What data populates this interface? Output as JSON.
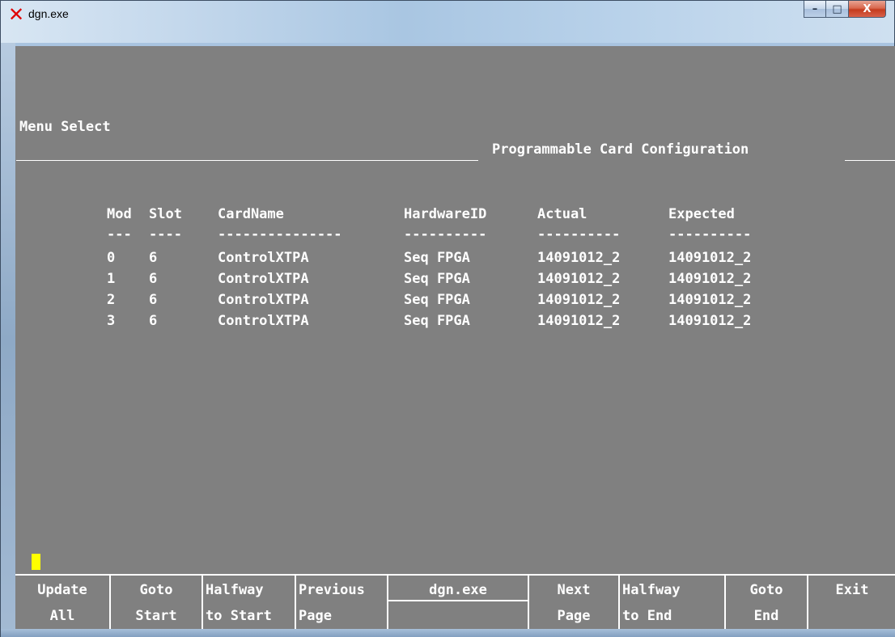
{
  "window": {
    "title": "dgn.exe",
    "minimize_glyph": "–",
    "maximize_glyph": "□",
    "close_glyph": "X",
    "app_icon": "x-logo-icon"
  },
  "screen": {
    "menu_label": "Menu Select",
    "section_title": "Programmable Card Configuration"
  },
  "table": {
    "headers": [
      "Mod",
      "Slot",
      "CardName",
      "HardwareID",
      "Actual",
      "Expected"
    ],
    "separators": [
      "---",
      "----",
      "---------------",
      "----------",
      "----------",
      "----------"
    ],
    "rows": [
      [
        "0",
        "6",
        "ControlXTPA",
        "Seq FPGA",
        "14091012_2",
        "14091012_2"
      ],
      [
        "1",
        "6",
        "ControlXTPA",
        "Seq FPGA",
        "14091012_2",
        "14091012_2"
      ],
      [
        "2",
        "6",
        "ControlXTPA",
        "Seq FPGA",
        "14091012_2",
        "14091012_2"
      ],
      [
        "3",
        "6",
        "ControlXTPA",
        "Seq FPGA",
        "14091012_2",
        "14091012_2"
      ]
    ]
  },
  "function_keys": [
    {
      "line1": "Update",
      "line2": "All"
    },
    {
      "line1": "Goto",
      "line2": "Start"
    },
    {
      "line1": "Halfway",
      "line2": "to Start"
    },
    {
      "line1": "Previous",
      "line2": "Page"
    },
    {
      "line1": "dgn.exe",
      "line2": ""
    },
    {
      "line1": "Next",
      "line2": "Page"
    },
    {
      "line1": "Halfway",
      "line2": "to End"
    },
    {
      "line1": "Goto",
      "line2": "End"
    },
    {
      "line1": "Exit",
      "line2": ""
    }
  ],
  "colors": {
    "console_bg": "#808080",
    "text": "#ffffff",
    "cursor": "#ffff00",
    "app_icon": "#e00000"
  }
}
